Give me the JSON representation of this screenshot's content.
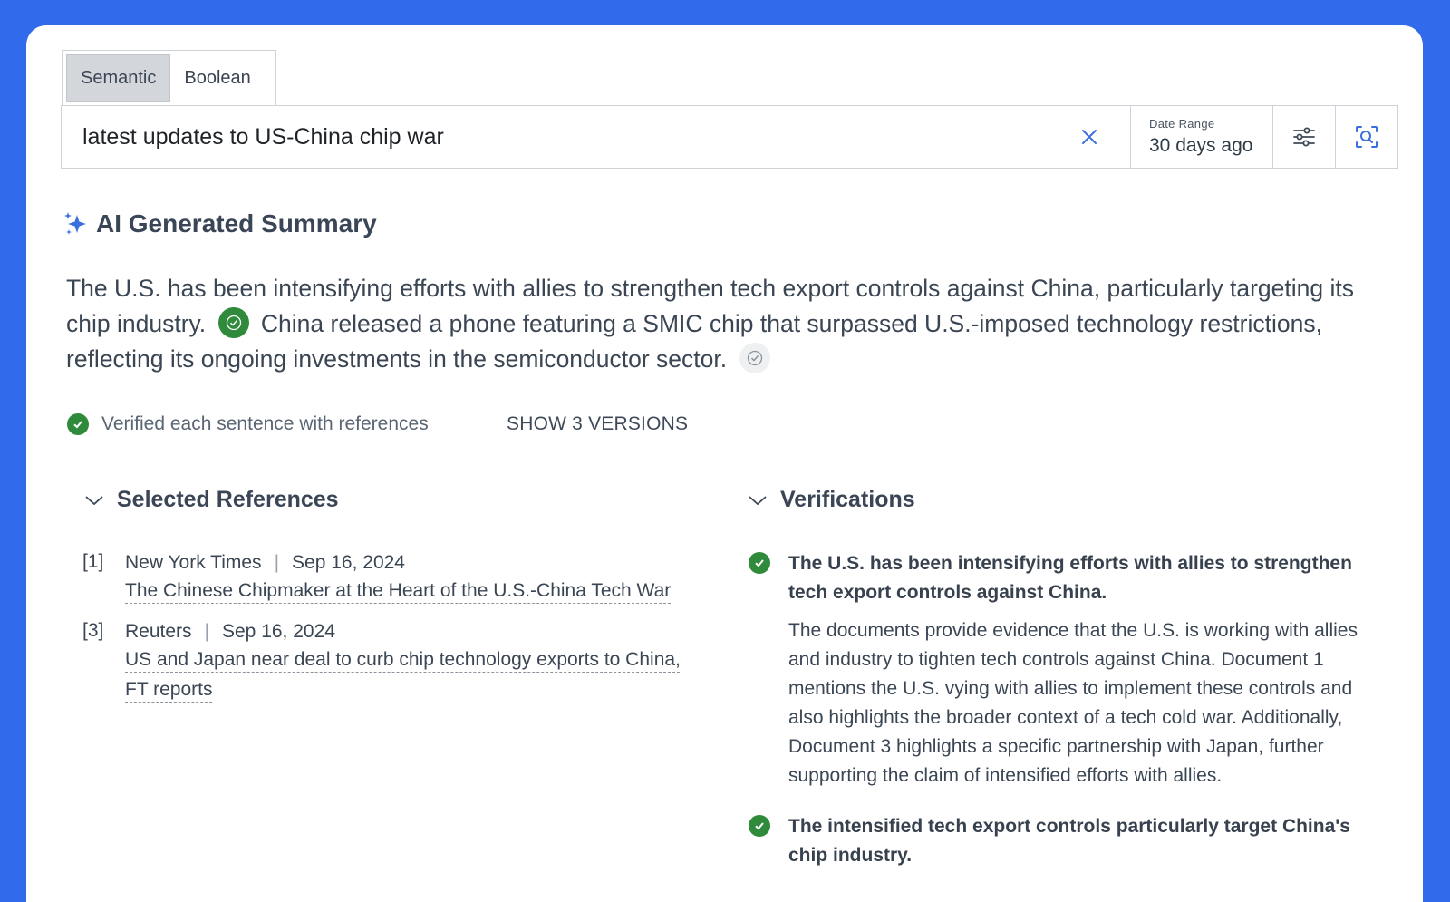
{
  "search": {
    "tabs": [
      {
        "label": "Semantic",
        "active": true
      },
      {
        "label": "Boolean",
        "active": false
      }
    ],
    "query": "latest updates to US-China chip war",
    "date_range_label": "Date Range",
    "date_range_value": "30 days ago"
  },
  "summary": {
    "title": "AI Generated Summary",
    "sentence1": "The U.S. has been intensifying efforts with allies to strengthen tech export controls against China, particularly targeting its chip industry.",
    "sentence2": "China released a phone featuring a SMIC chip that surpassed U.S.-imposed technology restrictions, reflecting its ongoing investments in the semiconductor sector.",
    "verified_text": "Verified each sentence with references",
    "versions_label": "SHOW 3 VERSIONS"
  },
  "references": {
    "title": "Selected References",
    "items": [
      {
        "num": "[1]",
        "source": "New York Times",
        "date": "Sep 16, 2024",
        "title": "The Chinese Chipmaker at the Heart of the U.S.-China Tech War"
      },
      {
        "num": "[3]",
        "source": "Reuters",
        "date": "Sep 16, 2024",
        "title": "US and Japan near deal to curb chip technology exports to China, FT reports"
      }
    ]
  },
  "verifications": {
    "title": "Verifications",
    "items": [
      {
        "claim": "The U.S. has been intensifying efforts with allies to strengthen tech export controls against China.",
        "explanation": "The documents provide evidence that the U.S. is working with allies and industry to tighten tech controls against China. Document 1 mentions the U.S. vying with allies to implement these controls and also highlights the broader context of a tech cold war. Additionally, Document 3 highlights a specific partnership with Japan, further supporting the claim of intensified efforts with allies."
      },
      {
        "claim": "The intensified tech export controls particularly target China's chip industry.",
        "explanation": ""
      }
    ]
  },
  "colors": {
    "background": "#316AEA",
    "verified_green": "#2f8a3b",
    "accent_blue": "#3b6fe0"
  },
  "icons": [
    "clear-icon",
    "filter-sliders-icon",
    "search-scan-icon",
    "sparkle-icon",
    "check-badge-icon",
    "chevron-down-icon"
  ]
}
